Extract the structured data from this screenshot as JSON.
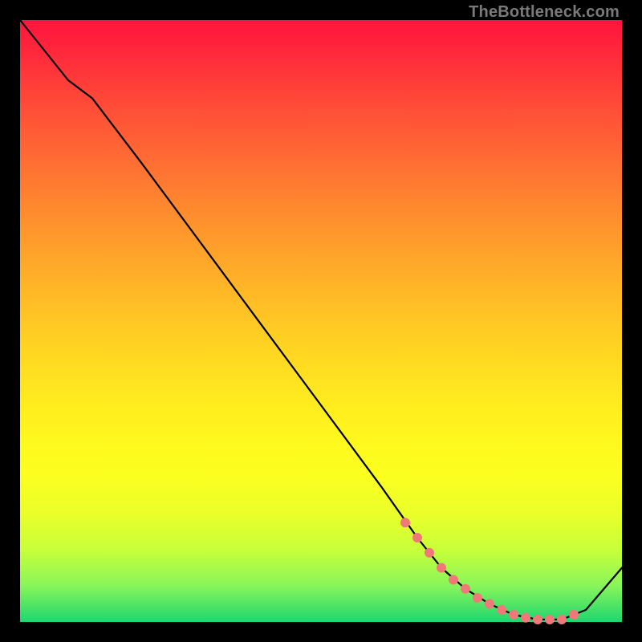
{
  "watermark": "TheBottleneck.com",
  "colors": {
    "background": "#000000",
    "gradient_top": "#ff143c",
    "gradient_mid": "#fff81d",
    "gradient_bottom": "#1ed66f",
    "curve": "#000000",
    "marker": "#f07878"
  },
  "chart_data": {
    "type": "line",
    "title": "",
    "xlabel": "",
    "ylabel": "",
    "xlim": [
      0,
      100
    ],
    "ylim": [
      0,
      100
    ],
    "grid": false,
    "legend": false,
    "series": [
      {
        "name": "curve",
        "x": [
          0,
          8,
          12,
          20,
          30,
          40,
          50,
          60,
          66,
          70,
          74,
          78,
          82,
          86,
          90,
          94,
          100
        ],
        "y": [
          100,
          90,
          87,
          76.5,
          63,
          49.5,
          36,
          22.5,
          14,
          9,
          5.5,
          3,
          1.2,
          0.4,
          0.4,
          2,
          9
        ]
      }
    ],
    "markers": {
      "series": "curve",
      "x": [
        64,
        66,
        68,
        70,
        72,
        74,
        76,
        78,
        80,
        82,
        84,
        86,
        88,
        90,
        92
      ],
      "y": [
        16.5,
        14,
        11.5,
        9,
        7,
        5.5,
        4,
        3,
        2,
        1.2,
        0.7,
        0.4,
        0.4,
        0.4,
        1.2
      ]
    }
  }
}
